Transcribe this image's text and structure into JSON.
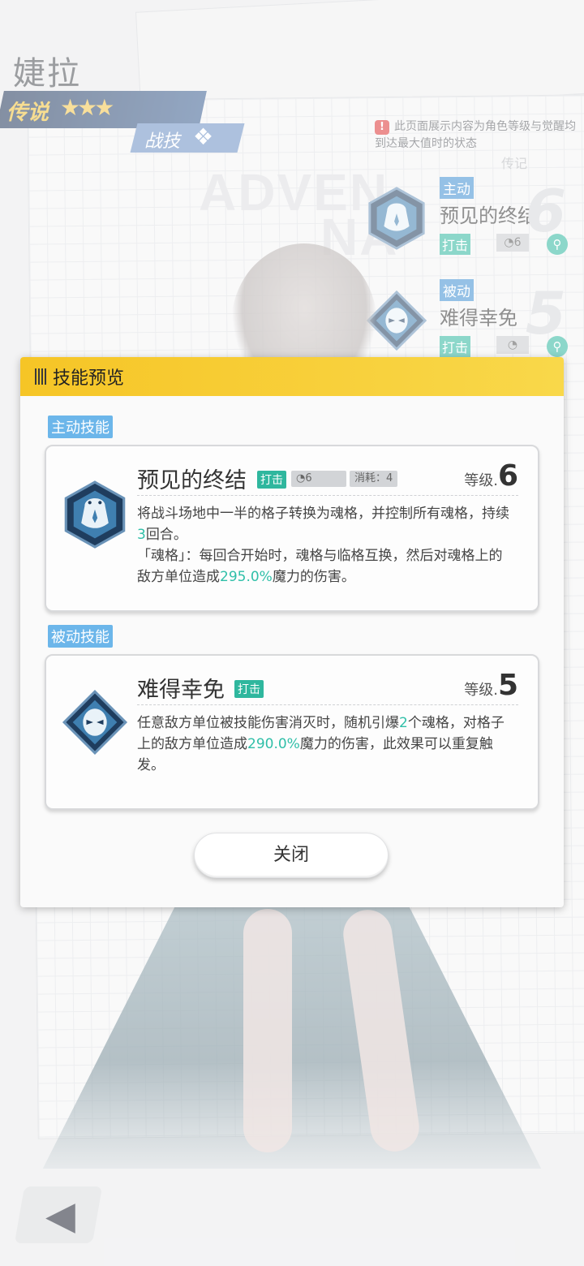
{
  "character": {
    "name": "婕拉",
    "rarity": "传说",
    "stars": "★★★",
    "tab": "战技"
  },
  "notice": "此页面展示内容为角色等级与觉醒均到达最大值时的状态",
  "background_text": [
    "ADVEN",
    "NA",
    "传记"
  ],
  "side_skills": [
    {
      "tag": "主动",
      "name": "预见的终结",
      "type": "打击",
      "cooldown": "6",
      "level": "6"
    },
    {
      "tag": "被动",
      "name": "难得幸免",
      "type": "打击",
      "cooldown": "",
      "level": "5"
    }
  ],
  "dialog": {
    "title": "技能预览",
    "active_section": "主动技能",
    "passive_section": "被动技能",
    "close_label": "关闭",
    "active_skill": {
      "name": "预见的终结",
      "type": "打击",
      "cooldown": "6",
      "cost": "消耗：4",
      "level_label": "等级.",
      "level": "6",
      "desc_part1": "将战斗场地中一半的格子转换为魂格，并控制所有魂格，持续",
      "desc_num1": "3",
      "desc_part2": "回合。",
      "desc_part3": "「魂格」：每回合开始时，魂格与临格互换，然后对魂格上的敌方单位造成",
      "desc_num2": "295.0%",
      "desc_part4": "魔力的伤害。"
    },
    "passive_skill": {
      "name": "难得幸免",
      "type": "打击",
      "level_label": "等级.",
      "level": "5",
      "desc_part1": "任意敌方单位被技能伤害消灭时，随机引爆",
      "desc_num1": "2",
      "desc_part2": "个魂格，对格子上的敌方单位造成",
      "desc_num2": "290.0%",
      "desc_part3": "魔力的伤害，此效果可以重复触发。"
    }
  },
  "colors": {
    "accent_yellow": "#f6c526",
    "tag_green": "#2fb79e",
    "section_blue": "#6cb6ea",
    "highlight": "#2fbfa8"
  },
  "icons": [
    "warning-icon",
    "active-skill-icon",
    "passive-skill-icon",
    "magnifier-icon",
    "back-arrow-icon",
    "cooldown-icon"
  ]
}
